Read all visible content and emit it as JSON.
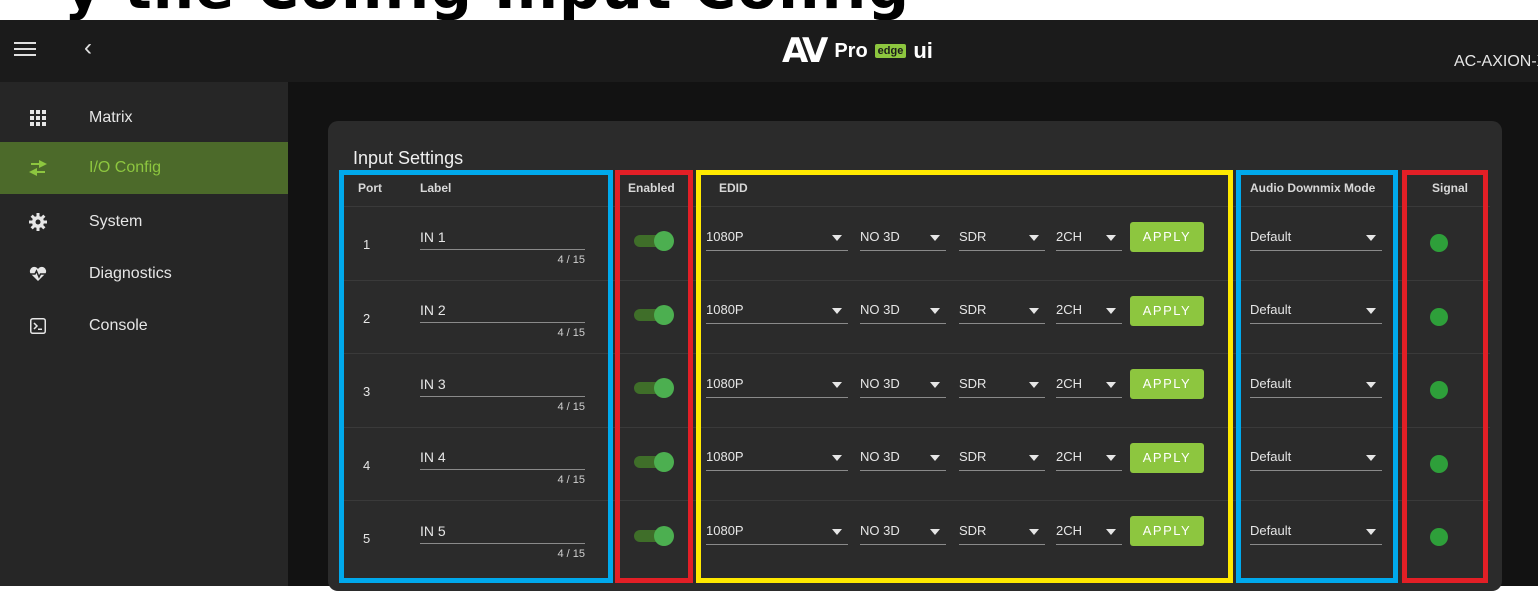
{
  "top_heading": "y the Config Input Config",
  "appbar": {
    "device_name": "AC-AXION-X",
    "logo": {
      "av": "AV",
      "pro": "Pro",
      "edge": "edge",
      "ui": "ui"
    }
  },
  "sidebar": {
    "items": [
      {
        "label": "Matrix",
        "icon": "grid-icon"
      },
      {
        "label": "I/O Config",
        "icon": "swap-arrows-icon",
        "active": true
      },
      {
        "label": "System",
        "icon": "gear-icon"
      },
      {
        "label": "Diagnostics",
        "icon": "heart-pulse-icon"
      },
      {
        "label": "Console",
        "icon": "terminal-icon"
      }
    ]
  },
  "input_settings": {
    "title": "Input Settings",
    "headers": {
      "port": "Port",
      "label": "Label",
      "enabled": "Enabled",
      "edid": "EDID",
      "audio": "Audio Downmix Mode",
      "signal": "Signal"
    },
    "apply_label": "APPLY",
    "rows": [
      {
        "port": "1",
        "label": "IN 1",
        "count": "4 / 15",
        "enabled": true,
        "resolution": "1080P",
        "mode3d": "NO 3D",
        "hdr": "SDR",
        "channels": "2CH",
        "audio": "Default",
        "signal": true
      },
      {
        "port": "2",
        "label": "IN 2",
        "count": "4 / 15",
        "enabled": true,
        "resolution": "1080P",
        "mode3d": "NO 3D",
        "hdr": "SDR",
        "channels": "2CH",
        "audio": "Default",
        "signal": true
      },
      {
        "port": "3",
        "label": "IN 3",
        "count": "4 / 15",
        "enabled": true,
        "resolution": "1080P",
        "mode3d": "NO 3D",
        "hdr": "SDR",
        "channels": "2CH",
        "audio": "Default",
        "signal": true
      },
      {
        "port": "4",
        "label": "IN 4",
        "count": "4 / 15",
        "enabled": true,
        "resolution": "1080P",
        "mode3d": "NO 3D",
        "hdr": "SDR",
        "channels": "2CH",
        "audio": "Default",
        "signal": true
      },
      {
        "port": "5",
        "label": "IN 5",
        "count": "4 / 15",
        "enabled": true,
        "resolution": "1080P",
        "mode3d": "NO 3D",
        "hdr": "SDR",
        "channels": "2CH",
        "audio": "Default",
        "signal": true
      }
    ]
  },
  "colors": {
    "accent": "#8dc63f",
    "highlight_blue": "#00a9ec",
    "highlight_red": "#e21f26",
    "highlight_yellow": "#ffe900",
    "signal_on": "#2e9f3a"
  }
}
